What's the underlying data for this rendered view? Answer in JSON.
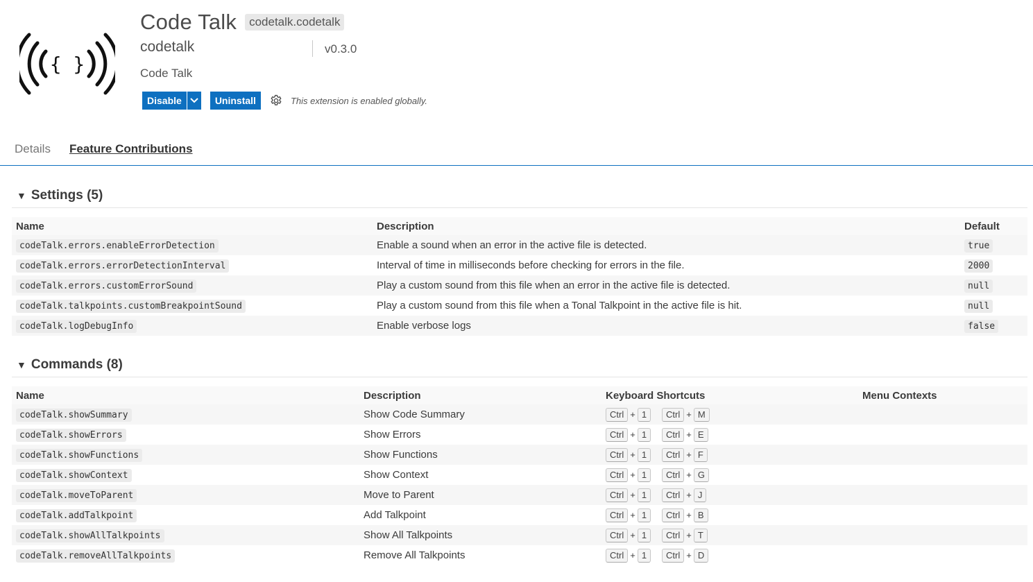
{
  "extension": {
    "name": "Code Talk",
    "identifier": "codetalk.codetalk",
    "publisher": "codetalk",
    "version": "v0.3.0",
    "description": "Code Talk",
    "logo_glyph": "{ }",
    "logo_icon": "broadcast-braces-icon"
  },
  "actions": {
    "disable_label": "Disable",
    "uninstall_label": "Uninstall",
    "status_text": "This extension is enabled globally.",
    "accent_color": "#0e70c0"
  },
  "tabs": [
    {
      "label": "Details",
      "active": false
    },
    {
      "label": "Feature Contributions",
      "active": true
    }
  ],
  "settings": {
    "title": "Settings (5)",
    "columns": [
      "Name",
      "Description",
      "Default"
    ],
    "rows": [
      {
        "name": "codeTalk.errors.enableErrorDetection",
        "description": "Enable a sound when an error in the active file is detected.",
        "default": "true"
      },
      {
        "name": "codeTalk.errors.errorDetectionInterval",
        "description": "Interval of time in milliseconds before checking for errors in the file.",
        "default": "2000"
      },
      {
        "name": "codeTalk.errors.customErrorSound",
        "description": "Play a custom sound from this file when an error in the active file is detected.",
        "default": "null"
      },
      {
        "name": "codeTalk.talkpoints.customBreakpointSound",
        "description": "Play a custom sound from this file when a Tonal Talkpoint in the active file is hit.",
        "default": "null"
      },
      {
        "name": "codeTalk.logDebugInfo",
        "description": "Enable verbose logs",
        "default": "false"
      }
    ]
  },
  "commands": {
    "title": "Commands (8)",
    "columns": [
      "Name",
      "Description",
      "Keyboard Shortcuts",
      "Menu Contexts"
    ],
    "rows": [
      {
        "name": "codeTalk.showSummary",
        "description": "Show Code Summary",
        "keys": [
          "Ctrl",
          "1",
          "Ctrl",
          "M"
        ]
      },
      {
        "name": "codeTalk.showErrors",
        "description": "Show Errors",
        "keys": [
          "Ctrl",
          "1",
          "Ctrl",
          "E"
        ]
      },
      {
        "name": "codeTalk.showFunctions",
        "description": "Show Functions",
        "keys": [
          "Ctrl",
          "1",
          "Ctrl",
          "F"
        ]
      },
      {
        "name": "codeTalk.showContext",
        "description": "Show Context",
        "keys": [
          "Ctrl",
          "1",
          "Ctrl",
          "G"
        ]
      },
      {
        "name": "codeTalk.moveToParent",
        "description": "Move to Parent",
        "keys": [
          "Ctrl",
          "1",
          "Ctrl",
          "J"
        ]
      },
      {
        "name": "codeTalk.addTalkpoint",
        "description": "Add Talkpoint",
        "keys": [
          "Ctrl",
          "1",
          "Ctrl",
          "B"
        ]
      },
      {
        "name": "codeTalk.showAllTalkpoints",
        "description": "Show All Talkpoints",
        "keys": [
          "Ctrl",
          "1",
          "Ctrl",
          "T"
        ]
      },
      {
        "name": "codeTalk.removeAllTalkpoints",
        "description": "Remove All Talkpoints",
        "keys": [
          "Ctrl",
          "1",
          "Ctrl",
          "D"
        ]
      }
    ]
  }
}
